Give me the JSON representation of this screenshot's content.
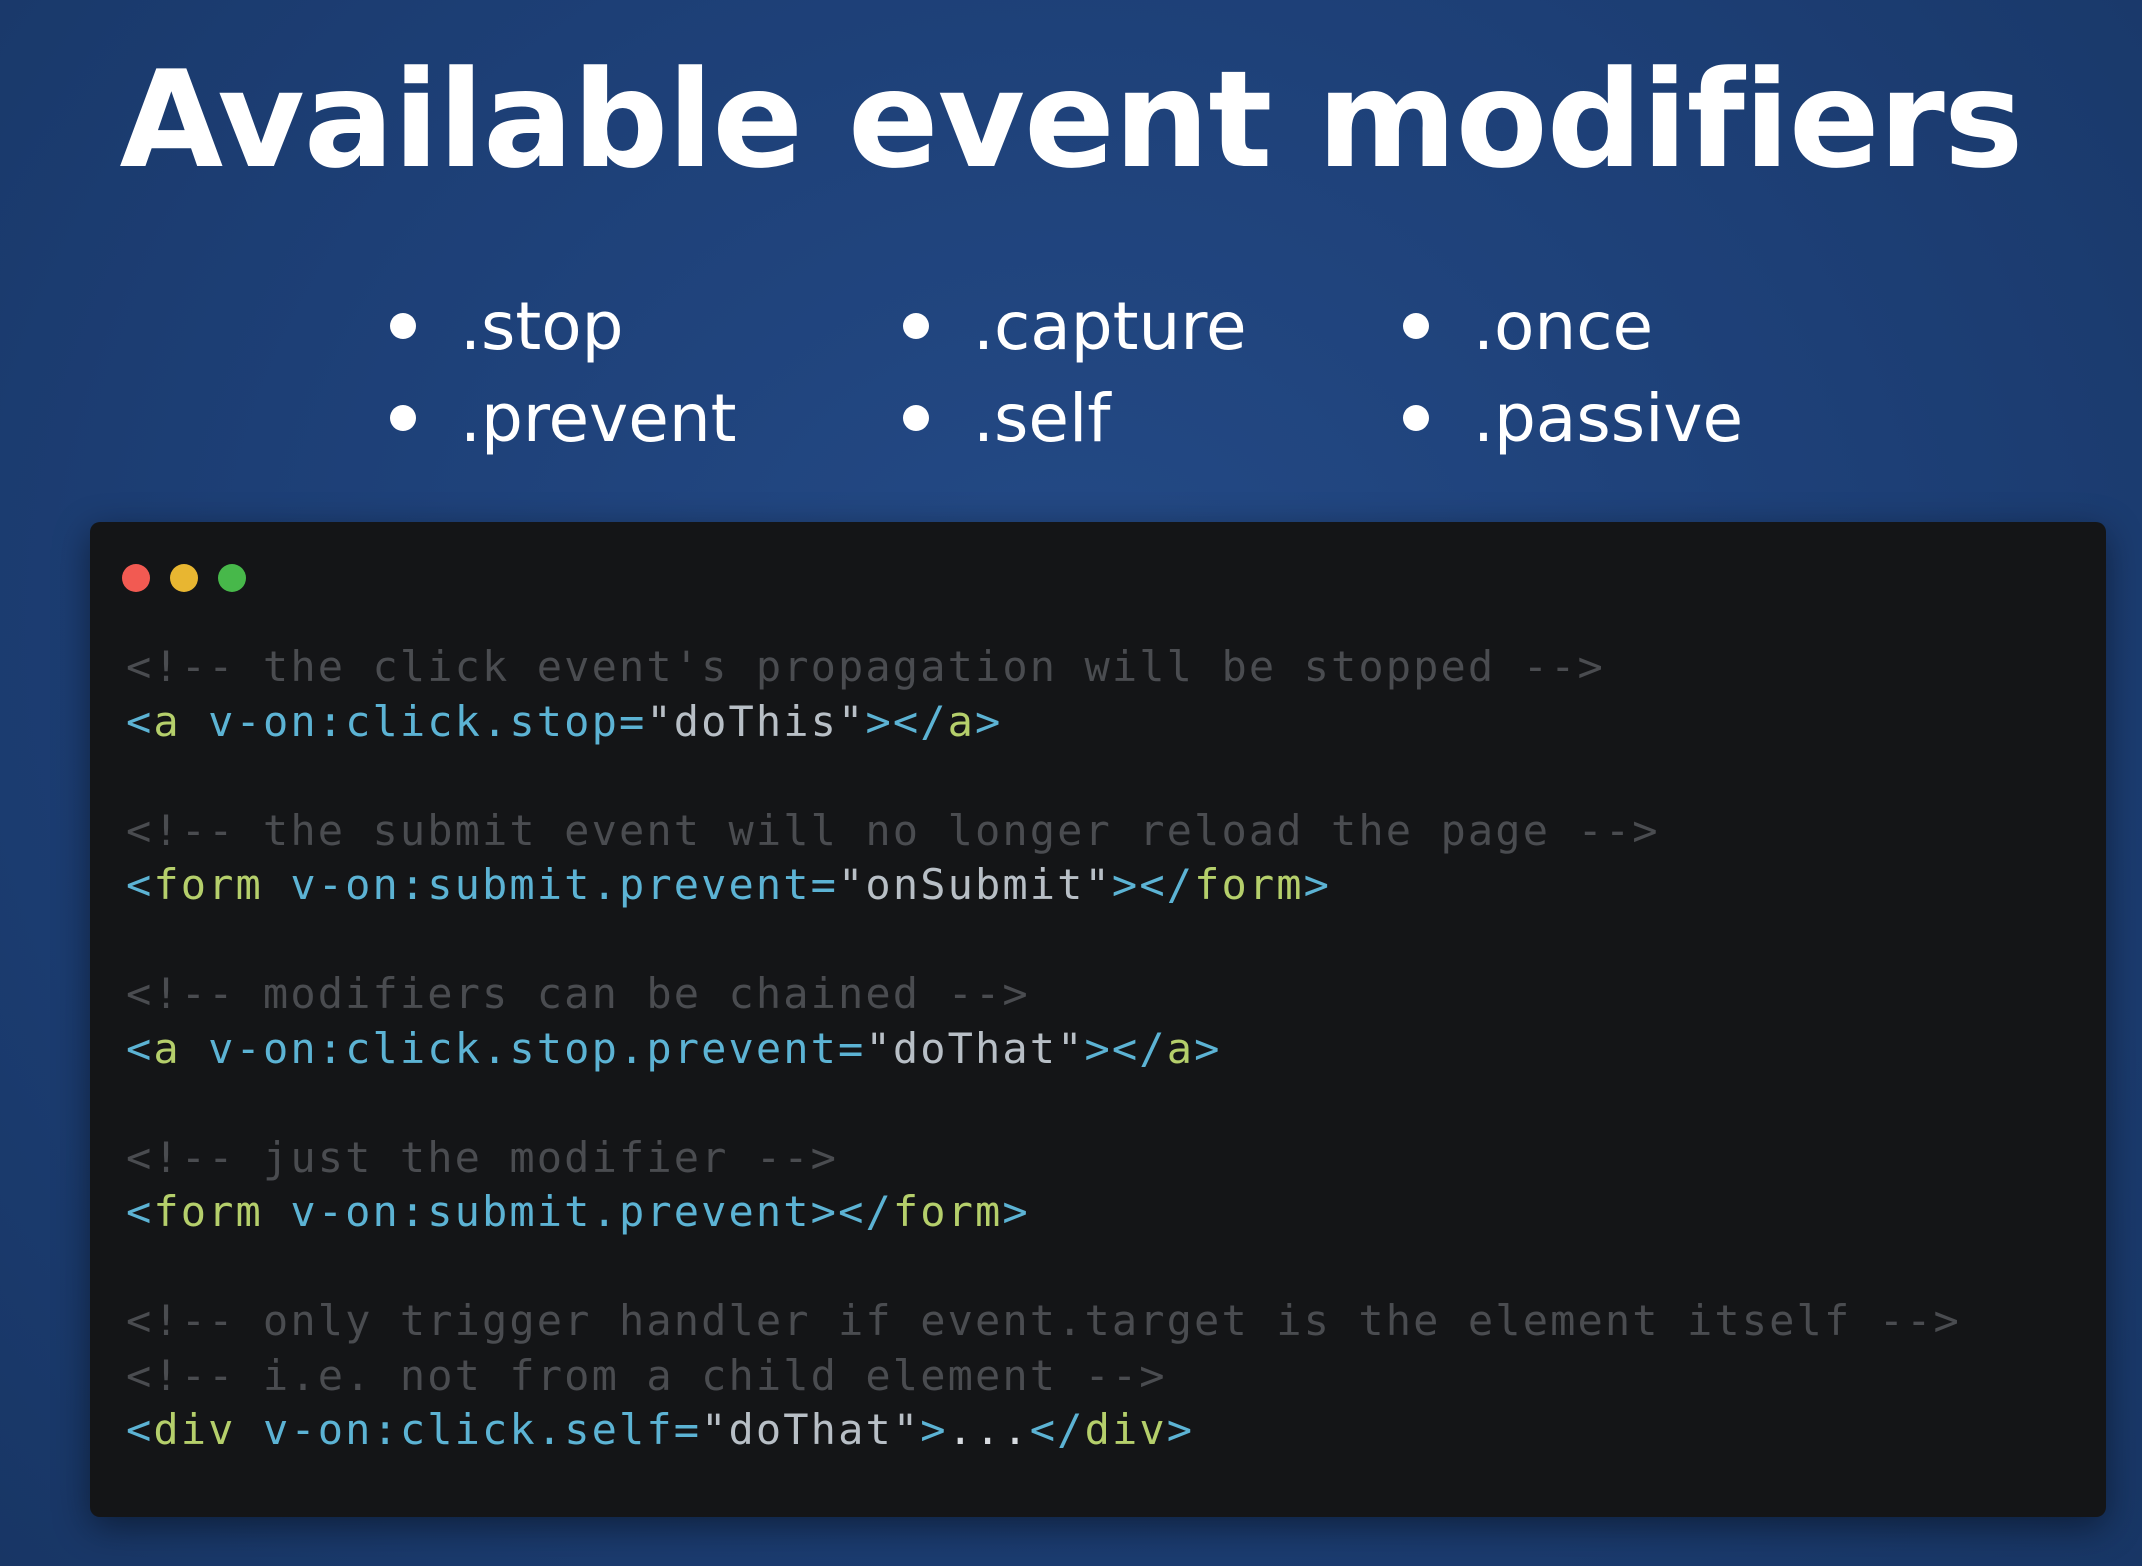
{
  "slide": {
    "title": "Available event modifiers"
  },
  "bullets": {
    "columns": [
      [
        ".stop",
        ".prevent"
      ],
      [
        ".capture",
        ".self"
      ],
      [
        ".once",
        ".passive"
      ]
    ]
  },
  "colors": {
    "background": "#1e4077",
    "code_background": "#141517",
    "traffic_red": "#f25a52",
    "traffic_yellow": "#e8b631",
    "traffic_green": "#47b84a",
    "comment": "#4a4c50",
    "tag": "#b5cf6b",
    "attribute": "#5cb3d4",
    "string": "#b8bfc6"
  },
  "code": {
    "window_controls": [
      "close-dot",
      "minimize-dot",
      "zoom-dot"
    ],
    "lines": [
      {
        "kind": "comment",
        "text": "<!-- the click event's propagation will be stopped -->"
      },
      {
        "kind": "code",
        "tag": "a",
        "attr": "v-on:click.stop=",
        "value": "\"doThis\"",
        "inner": ""
      },
      {
        "kind": "blank"
      },
      {
        "kind": "comment",
        "text": "<!-- the submit event will no longer reload the page -->"
      },
      {
        "kind": "code",
        "tag": "form",
        "attr": "v-on:submit.prevent=",
        "value": "\"onSubmit\"",
        "inner": ""
      },
      {
        "kind": "blank"
      },
      {
        "kind": "comment",
        "text": "<!-- modifiers can be chained -->"
      },
      {
        "kind": "code",
        "tag": "a",
        "attr": "v-on:click.stop.prevent=",
        "value": "\"doThat\"",
        "inner": ""
      },
      {
        "kind": "blank"
      },
      {
        "kind": "comment",
        "text": "<!-- just the modifier -->"
      },
      {
        "kind": "code",
        "tag": "form",
        "attr": "v-on:submit.prevent",
        "value": "",
        "inner": ""
      },
      {
        "kind": "blank"
      },
      {
        "kind": "comment",
        "text": "<!-- only trigger handler if event.target is the element itself -->"
      },
      {
        "kind": "comment",
        "text": "<!-- i.e. not from a child element -->"
      },
      {
        "kind": "code",
        "tag": "div",
        "attr": "v-on:click.self=",
        "value": "\"doThat\"",
        "inner": "..."
      }
    ]
  }
}
